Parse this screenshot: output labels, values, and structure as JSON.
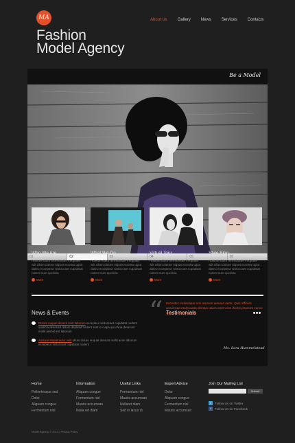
{
  "logo": {
    "initials": "MA",
    "title_line1": "Fashion",
    "title_line2": "Model Agency"
  },
  "nav": [
    {
      "label": "About Us",
      "active": true
    },
    {
      "label": "Gallery",
      "active": false
    },
    {
      "label": "News",
      "active": false
    },
    {
      "label": "Services",
      "active": false
    },
    {
      "label": "Contacts",
      "active": false
    }
  ],
  "slider": {
    "label": "Be a Model",
    "pages": [
      "01",
      "02",
      "03",
      "04",
      "05",
      "06"
    ],
    "active_page": "02"
  },
  "cards": [
    {
      "title": "Who We Are",
      "text": "Autsure dolor morethoder imoptate wilt ollum dolore niquat excerta ugiut dateu excepteur sintoccaet cupidatat notent sunt quolicia",
      "more": "More"
    },
    {
      "title": "What We Do",
      "text": "Autsure dolor morethoder imoptate wilt ollum dolore niquat excerta ugiut dateu excepteur sintoccaet cupidatat notent sunt quolicia",
      "more": "More"
    },
    {
      "title": "Virtual Tour",
      "text": "Autsure dolor morethoder imoptate wilt ollum dolore niquat excerta ugiut dateu excepteur sintoccaet cupidatat notent sunt quolicia",
      "more": "More"
    },
    {
      "title": "Style Blog",
      "text": "Autsure dolor morethoder imoptate wilt ollum dolore niquat excerta ugiut dateu excepteur sintoccaet cupidatat notent sunt quolicia",
      "more": "More"
    }
  ],
  "news": {
    "title": "News & Events",
    "items": [
      {
        "link": "Dolore nuquet deserit molt laborum",
        "text": "excepteur sintoccaet cupidatat nodent quolicia deserunt dolore dsplutat nodent sunt in culpa qui oficia deserunt mollit animid est laborum"
      },
      {
        "link": "Autsure Reprehedor velit",
        "text": "ollum dolore nuquat dserunt mollit anim laborum excepteur sintoccaet cupidatat nodent"
      }
    ]
  },
  "testimonials": {
    "title": "Testimonials",
    "text": "Eccerites molestique orci acusem aenean autor. Quis officiiss accumsan malesuada dientue utium amet eros ibertis pharetra conse ctetuer adipiscing elit.",
    "author": "Ms. Sara Hummelstead"
  },
  "footer": {
    "columns": [
      {
        "title": "Home",
        "links": [
          "Pellentesque sed",
          "Dolor",
          "Aliquam congue",
          "Fermentum nisl"
        ]
      },
      {
        "title": "Information",
        "links": [
          "Aliquam congue",
          "Fermentum nisl",
          "Mauris accumsan",
          "Nulla vel diam"
        ]
      },
      {
        "title": "Useful Links",
        "links": [
          "Fermentum nisl",
          "Mauris accumsan",
          "Nullaret diam",
          "Sed in lacus ut"
        ]
      },
      {
        "title": "Expert Advice",
        "links": [
          "Dolor",
          "Aliquam congue",
          "Fermentum nisl",
          "Mauris accumsan"
        ]
      }
    ],
    "join": {
      "title": "Join Our Mailing List",
      "placeholder": "",
      "button": "Submit"
    },
    "social": [
      {
        "label": "Follow Us on Twitter",
        "icon": "twitter-icon"
      },
      {
        "label": "Follow Us on Facebook",
        "icon": "facebook-icon"
      }
    ],
    "copyright": "Model Agency © 2012 | Privacy Policy"
  },
  "colors": {
    "accent": "#e2512a",
    "background": "#1f1f1f",
    "panel": "#111111"
  }
}
